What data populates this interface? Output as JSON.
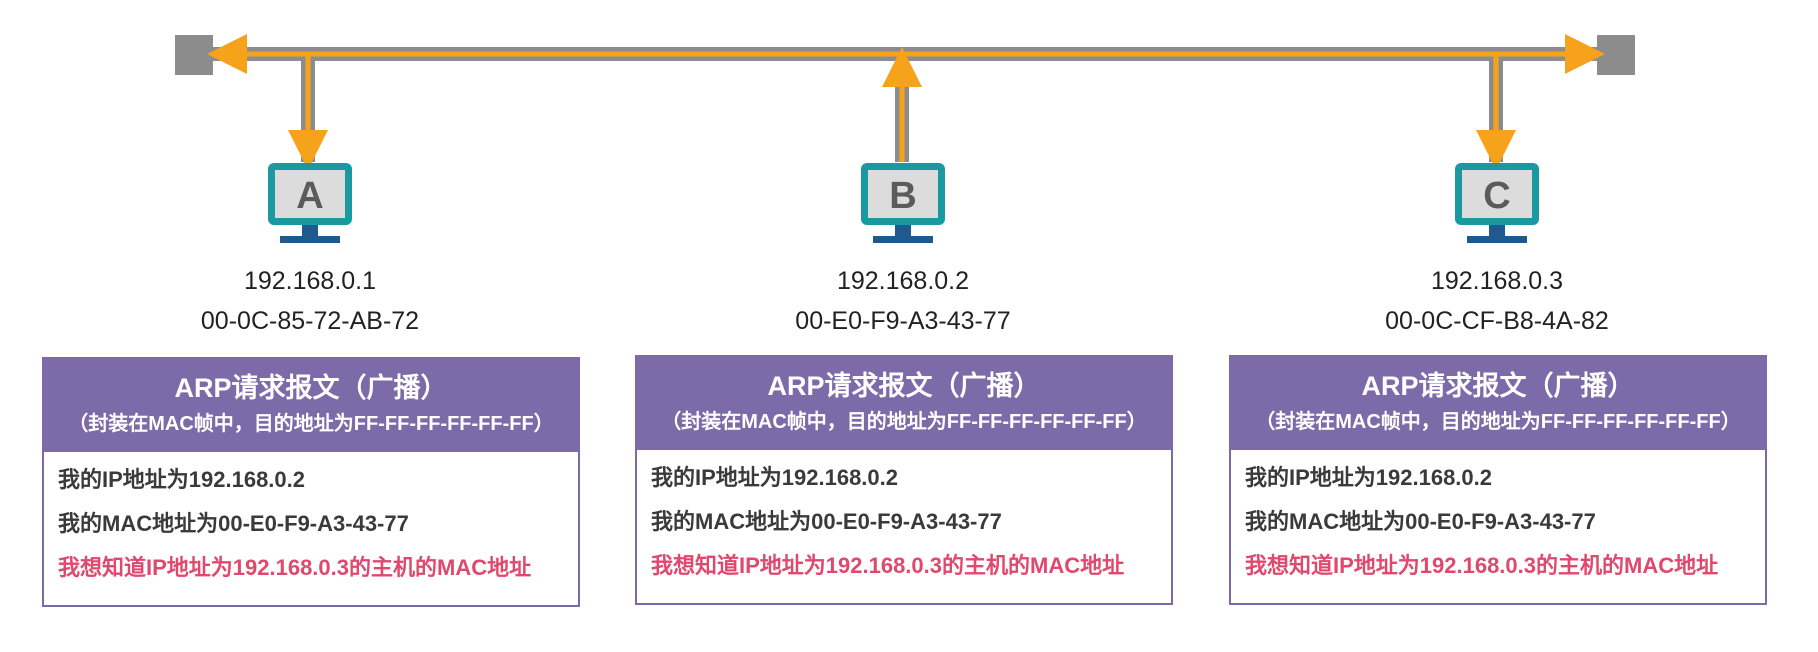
{
  "colors": {
    "bus": "#8c8c8c",
    "arrow": "#f6a31b",
    "monitor_frame": "#1a9aa0",
    "monitor_screen": "#dcdcdc",
    "monitor_stand": "#1e5a8e",
    "box_header": "#7d6aa8",
    "question_text": "#e0486e"
  },
  "hosts": [
    {
      "letter": "A",
      "ip": "192.168.0.1",
      "mac": "00-0C-85-72-AB-72",
      "arp": {
        "title": "ARP请求报文（广播）",
        "subtitle": "（封装在MAC帧中，目的地址为FF-FF-FF-FF-FF-FF）",
        "line1": "我的IP地址为192.168.0.2",
        "line2": "我的MAC地址为00-E0-F9-A3-43-77",
        "line3": "我想知道IP地址为192.168.0.3的主机的MAC地址"
      }
    },
    {
      "letter": "B",
      "ip": "192.168.0.2",
      "mac": "00-E0-F9-A3-43-77",
      "arp": {
        "title": "ARP请求报文（广播）",
        "subtitle": "（封装在MAC帧中，目的地址为FF-FF-FF-FF-FF-FF）",
        "line1": "我的IP地址为192.168.0.2",
        "line2": "我的MAC地址为00-E0-F9-A3-43-77",
        "line3": "我想知道IP地址为192.168.0.3的主机的MAC地址"
      }
    },
    {
      "letter": "C",
      "ip": "192.168.0.3",
      "mac": "00-0C-CF-B8-4A-82",
      "arp": {
        "title": "ARP请求报文（广播）",
        "subtitle": "（封装在MAC帧中，目的地址为FF-FF-FF-FF-FF-FF）",
        "line1": "我的IP地址为192.168.0.2",
        "line2": "我的MAC地址为00-E0-F9-A3-43-77",
        "line3": "我想知道IP地址为192.168.0.3的主机的MAC地址"
      }
    }
  ]
}
